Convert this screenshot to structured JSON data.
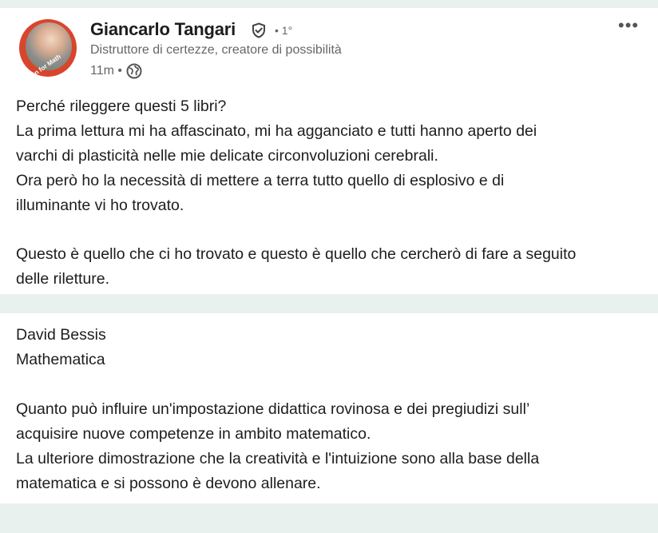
{
  "post": {
    "author_name": "Giancarlo Tangari",
    "degree": "• 1°",
    "headline": "Distruttore di certezze, creatore di possibilità",
    "time": "11m •",
    "more_label": "•••",
    "avatar_text": "Open for Math",
    "icons": {
      "verified": "verified-shield-icon",
      "visibility": "globe-icon",
      "more": "more-options-icon"
    },
    "body_lines": [
      "Perché rileggere questi 5 libri?",
      "La prima lettura mi ha affascinato, mi ha agganciato e tutti hanno aperto dei",
      "varchi di plasticità nelle mie delicate circonvoluzioni cerebrali.",
      "Ora però ho la necessità di mettere a terra tutto quello di esplosivo e di",
      "illuminante vi ho trovato.",
      "Questo è quello che ci ho trovato e questo è quello che cercherò di fare a seguito",
      "delle riletture."
    ]
  },
  "book": {
    "lines": [
      "David Bessis",
      "Mathematica",
      "Quanto può influire un'impostazione didattica rovinosa e dei pregiudizi sull’",
      "acquisire nuove competenze in ambito matematico.",
      "La ulteriore dimostrazione che la creatività e l'intuizione sono alla base della",
      "matematica e si possono è devono allenare."
    ]
  },
  "colors": {
    "page_bg": "#e9f1ee",
    "card_bg": "#ffffff",
    "text": "#1d1d1d",
    "muted": "#666666",
    "avatar_ring": "#d8452d"
  }
}
